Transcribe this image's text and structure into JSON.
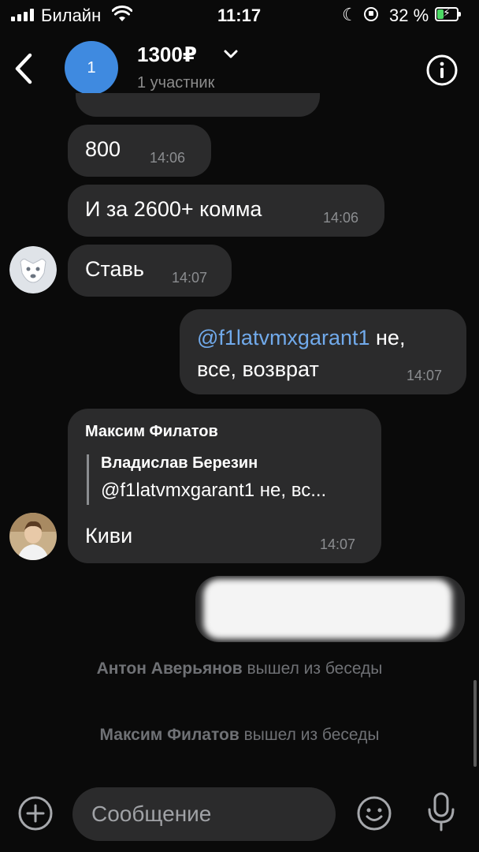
{
  "status_bar": {
    "carrier": "Билайн",
    "time": "11:17",
    "battery_percent": "32 %",
    "battery_level": 0.32,
    "icons": [
      "signal-icon",
      "wifi-icon",
      "moon-icon",
      "rotation-lock-icon",
      "battery-charging-icon"
    ]
  },
  "header": {
    "avatar_letter": "1",
    "title": "1300₽",
    "subtitle": "1 участник",
    "icons": [
      "back-icon",
      "chevron-down-icon",
      "info-icon"
    ]
  },
  "messages": {
    "m1": {
      "text": "800",
      "time": "14:06"
    },
    "m2": {
      "text": "И за 2600+ комма",
      "time": "14:06"
    },
    "m3": {
      "text": "Ставь",
      "time": "14:07"
    },
    "m4": {
      "mention": "@f1latvmxgarant1",
      "line1_rest": " не,",
      "line2": "все, возврат",
      "time": "14:07"
    },
    "m5": {
      "author": "Максим Филатов",
      "reply_name": "Владислав Березин",
      "reply_text": "@f1latvmxgarant1 не, вс...",
      "text": "Киви",
      "time": "14:07"
    }
  },
  "service": {
    "s1": {
      "name": "Антон Аверьянов",
      "action": " вышел из беседы"
    },
    "s2": {
      "name": "Максим Филатов",
      "action": " вышел из беседы"
    }
  },
  "composer": {
    "placeholder": "Сообщение",
    "icons": [
      "plus-icon",
      "emoji-icon",
      "microphone-icon"
    ]
  },
  "colors": {
    "background": "#0a0a0a",
    "bubble": "#2b2b2c",
    "accent": "#3f8ae0",
    "mention": "#71aaeb",
    "muted": "#8b8d90"
  }
}
